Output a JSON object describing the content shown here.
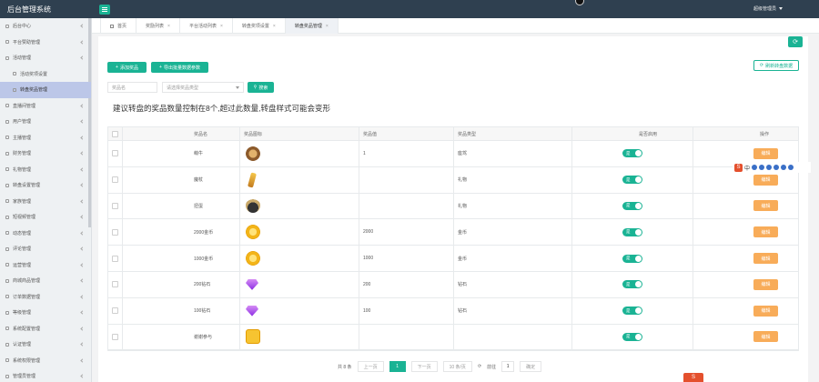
{
  "app": {
    "title": "后台管理系统",
    "user": "超级管理员"
  },
  "sidebar": {
    "items": [
      {
        "label": "后台中心",
        "sub": false,
        "active": false
      },
      {
        "label": "平台赞助管理",
        "sub": false,
        "active": false
      },
      {
        "label": "活动管理",
        "sub": false,
        "active": false
      },
      {
        "label": "活动奖项设置",
        "sub": true,
        "active": false
      },
      {
        "label": "转盘奖品管理",
        "sub": true,
        "active": true
      },
      {
        "label": "直播间管理",
        "sub": false,
        "active": false
      },
      {
        "label": "用户管理",
        "sub": false,
        "active": false
      },
      {
        "label": "主播管理",
        "sub": false,
        "active": false
      },
      {
        "label": "财务管理",
        "sub": false,
        "active": false
      },
      {
        "label": "礼物管理",
        "sub": false,
        "active": false
      },
      {
        "label": "转盘设置管理",
        "sub": false,
        "active": false
      },
      {
        "label": "家族管理",
        "sub": false,
        "active": false
      },
      {
        "label": "短视频管理",
        "sub": false,
        "active": false
      },
      {
        "label": "动态管理",
        "sub": false,
        "active": false
      },
      {
        "label": "评论管理",
        "sub": false,
        "active": false
      },
      {
        "label": "运营管理",
        "sub": false,
        "active": false
      },
      {
        "label": "商城商品管理",
        "sub": false,
        "active": false
      },
      {
        "label": "订单数据管理",
        "sub": false,
        "active": false
      },
      {
        "label": "等级管理",
        "sub": false,
        "active": false
      },
      {
        "label": "系统配置管理",
        "sub": false,
        "active": false
      },
      {
        "label": "认证管理",
        "sub": false,
        "active": false
      },
      {
        "label": "系统权限管理",
        "sub": false,
        "active": false
      },
      {
        "label": "管理员管理",
        "sub": false,
        "active": false
      }
    ]
  },
  "tabs": [
    {
      "label": "首页",
      "active": false,
      "home": true
    },
    {
      "label": "奖励列表",
      "active": false
    },
    {
      "label": "平台活动列表",
      "active": false
    },
    {
      "label": "转盘奖项设置",
      "active": false
    },
    {
      "label": "转盘奖品管理",
      "active": true
    }
  ],
  "toolbar": {
    "add_label": "添加奖品",
    "batch_label": "导出批量数据参数",
    "reset_label": "刷新转盘数据",
    "search_label": "搜索",
    "name_placeholder": "奖品名",
    "type_placeholder": "请选择奖品类型"
  },
  "notice": "建议转盘的奖品数量控制在8个,超过此数量,转盘样式可能会变形",
  "table": {
    "headers": [
      "",
      "奖品名",
      "奖品图标",
      "奖品值",
      "奖品类型",
      "是否启用",
      "操作"
    ],
    "rows": [
      {
        "name": "萌牛",
        "img": "bear",
        "value": "1",
        "type": "座驾",
        "enabled": "是",
        "action": "编辑"
      },
      {
        "name": "魔杖",
        "img": "stick",
        "value": "",
        "type": "礼物",
        "enabled": "是",
        "action": "编辑"
      },
      {
        "name": "扭蛋",
        "img": "egg",
        "value": "",
        "type": "礼物",
        "enabled": "是",
        "action": "编辑"
      },
      {
        "name": "2000金币",
        "img": "coin",
        "value": "2000",
        "type": "金币",
        "enabled": "是",
        "action": "编辑"
      },
      {
        "name": "1000金币",
        "img": "coin",
        "value": "1000",
        "type": "金币",
        "enabled": "是",
        "action": "编辑"
      },
      {
        "name": "200钻石",
        "img": "gem",
        "value": "200",
        "type": "钻石",
        "enabled": "是",
        "action": "编辑"
      },
      {
        "name": "100钻石",
        "img": "gem",
        "value": "100",
        "type": "钻石",
        "enabled": "是",
        "action": "编辑"
      },
      {
        "name": "谢谢参与",
        "img": "thanks",
        "value": "",
        "type": "",
        "enabled": "是",
        "action": "编辑"
      }
    ]
  },
  "pager": {
    "total": "共 8 条",
    "prev": "上一页",
    "current": "1",
    "next": "下一页",
    "page_size": "10 条/页",
    "goto_label": "前往",
    "goto_value": "1",
    "confirm": "确定"
  },
  "ime": {
    "logo": "S",
    "mode": "中"
  }
}
